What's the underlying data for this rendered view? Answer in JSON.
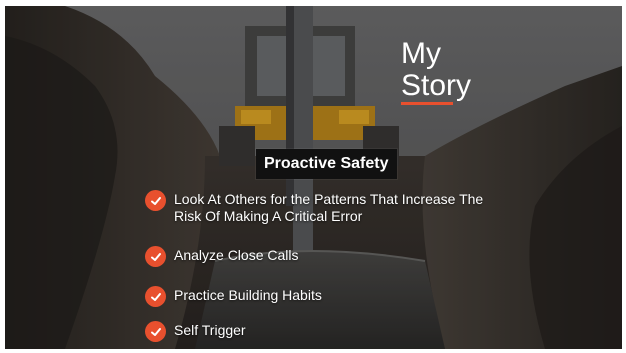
{
  "slide": {
    "title_line1": "My",
    "title_line2": "Story",
    "banner": "Proactive Safety",
    "bullets": [
      {
        "text": "Look At Others for the Patterns That Increase The  Risk Of Making A Critical Error",
        "icon": "check-icon"
      },
      {
        "text": "Analyze Close Calls",
        "icon": "check-icon"
      },
      {
        "text": "Practice Building Habits",
        "icon": "check-icon"
      },
      {
        "text": "Self Trigger",
        "icon": "check-icon"
      }
    ]
  },
  "colors": {
    "accent": "#e8502e",
    "text": "#ffffff",
    "banner_bg": "#111111"
  }
}
